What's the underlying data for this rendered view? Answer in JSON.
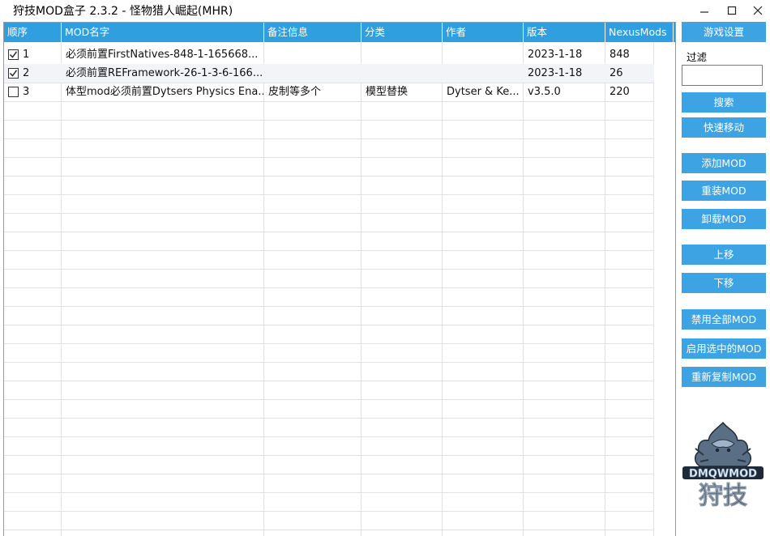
{
  "window": {
    "title": "狩技MOD盒子 2.3.2 - 怪物猎人崛起(MHR)"
  },
  "grid": {
    "columns": [
      "顺序",
      "MOD名字",
      "备注信息",
      "分类",
      "作者",
      "版本",
      "NexusMods"
    ],
    "rows": [
      {
        "checked": true,
        "order": "1",
        "name": "必须前置FirstNatives-848-1-165668...",
        "note": "",
        "category": "",
        "author": "",
        "version": "2023-1-18",
        "nexus": "848"
      },
      {
        "checked": true,
        "order": "2",
        "name": "必须前置REFramework-26-1-3-6-166...",
        "note": "",
        "category": "",
        "author": "",
        "version": "2023-1-18",
        "nexus": "26"
      },
      {
        "checked": false,
        "order": "3",
        "name": "体型mod必须前置Dytsers Physics Ena...",
        "note": "皮制等多个",
        "category": "模型替换",
        "author": "Dytser & Ke...",
        "version": "v3.5.0",
        "nexus": "220"
      }
    ]
  },
  "sidebar": {
    "game_settings": "游戏设置",
    "filter_label": "过滤",
    "filter_value": "",
    "search": "搜索",
    "quick_move": "快速移动",
    "add_mod": "添加MOD",
    "reinstall_mod": "重装MOD",
    "uninstall_mod": "卸载MOD",
    "move_up": "上移",
    "move_down": "下移",
    "disable_all": "禁用全部MOD",
    "enable_selected": "启用选中的MOD",
    "recopy": "重新复制MOD"
  },
  "logo": {
    "text_top": "DMQWMOD",
    "text_bottom": "狩技"
  },
  "colors": {
    "header_bg": "#2f9fe0",
    "button_bg": "#3ea3e2",
    "row_alt": "#f3f4f8",
    "grid_line": "#e3e3e3"
  }
}
